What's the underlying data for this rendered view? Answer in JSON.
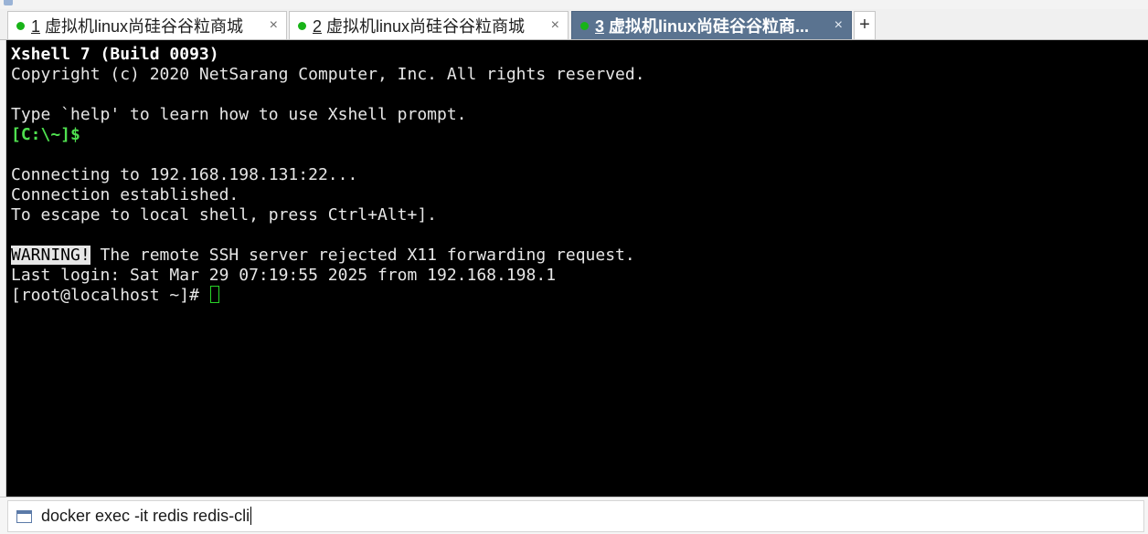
{
  "tabs": [
    {
      "number": "1",
      "title": " 虚拟机linux尚硅谷谷粒商城",
      "close": "×",
      "active": false
    },
    {
      "number": "2",
      "title": " 虚拟机linux尚硅谷谷粒商城",
      "close": "×",
      "active": false
    },
    {
      "number": "3",
      "title": " 虚拟机linux尚硅谷谷粒商...",
      "close": "×",
      "active": true
    }
  ],
  "add_tab_label": "+",
  "terminal": {
    "banner_title": "Xshell 7 (Build 0093)",
    "copyright": "Copyright (c) 2020 NetSarang Computer, Inc. All rights reserved.",
    "help_hint": "Type `help' to learn how to use Xshell prompt.",
    "local_prompt": "[C:\\~]$",
    "connecting": "Connecting to 192.168.198.131:22...",
    "established": "Connection established.",
    "escape_hint": "To escape to local shell, press Ctrl+Alt+].",
    "warning_badge": "WARNING!",
    "warning_text": " The remote SSH server rejected X11 forwarding request.",
    "last_login": "Last login: Sat Mar 29 07:19:55 2025 from 192.168.198.1",
    "remote_prompt": "[root@localhost ~]# "
  },
  "compose": {
    "text": "docker exec -it redis redis-cli"
  },
  "colors": {
    "active_tab_bg": "#5a7390",
    "session_dot": "#18b318",
    "terminal_bg": "#000000",
    "prompt_green": "#4fe04f"
  }
}
